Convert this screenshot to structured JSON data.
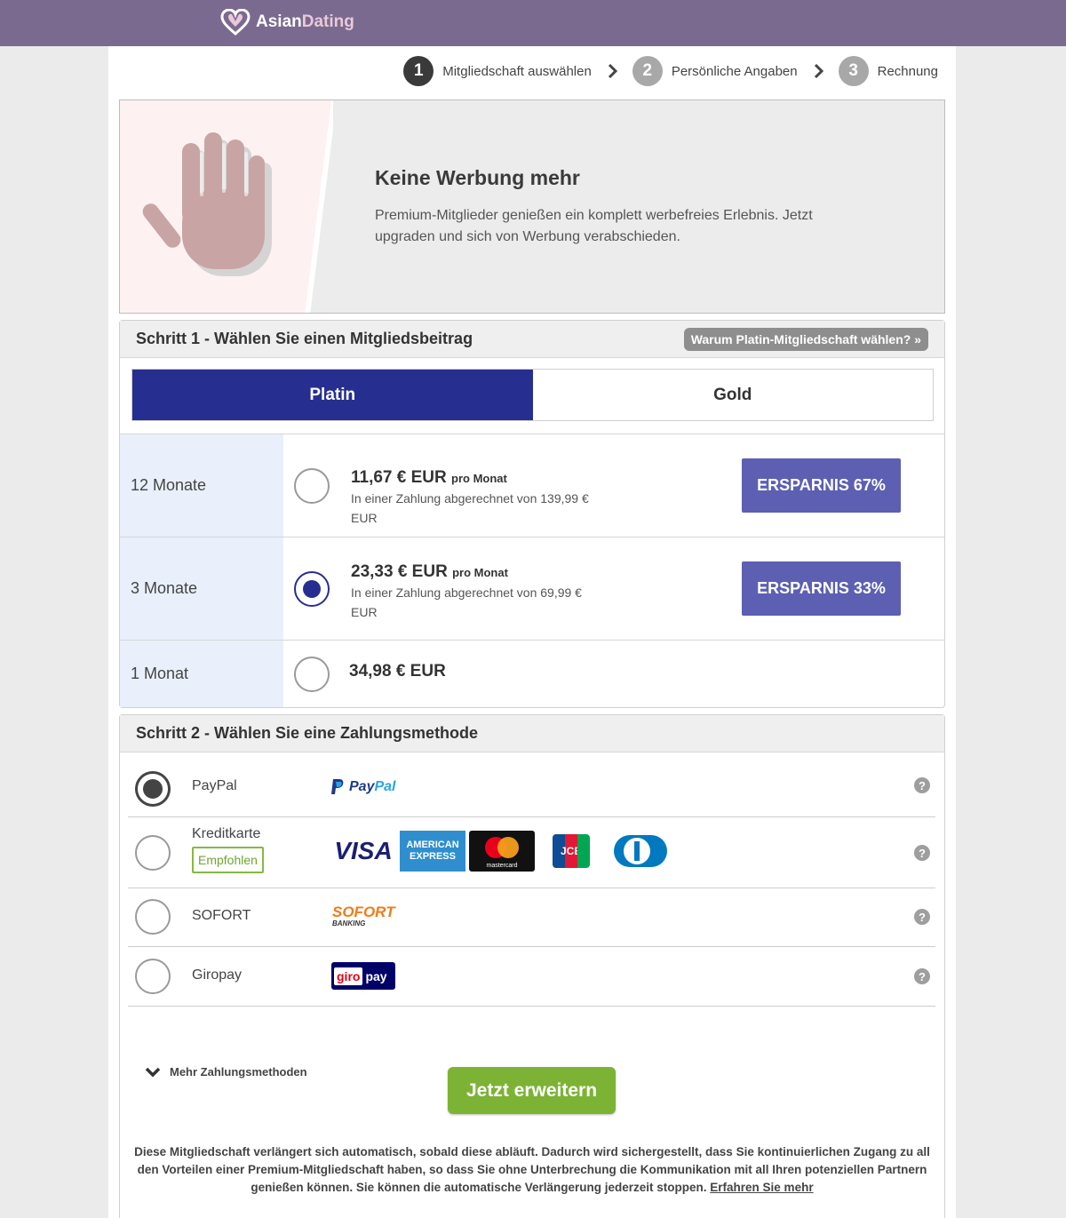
{
  "header": {
    "logo_part1": "Asian",
    "logo_part2": "Dating"
  },
  "steps": [
    {
      "num": "1",
      "label": "Mitgliedschaft auswählen"
    },
    {
      "num": "2",
      "label": "Persönliche Angaben"
    },
    {
      "num": "3",
      "label": "Rechnung"
    }
  ],
  "banner": {
    "title": "Keine Werbung mehr",
    "text": "Premium-Mitglieder genießen ein komplett werbefreies Erlebnis. Jetzt upgraden und sich von Werbung verabschieden."
  },
  "step1": {
    "title": "Schritt 1 - Wählen Sie einen Mitgliedsbeitrag",
    "why_button": "Warum Platin-Mitgliedschaft wählen? »",
    "tabs": [
      {
        "label": "Platin"
      },
      {
        "label": "Gold"
      }
    ],
    "plans": [
      {
        "duration": "12 Monate",
        "price": "11,67 € EUR",
        "per": "pro Monat",
        "billing": "In einer Zahlung abgerechnet von 139,99 € EUR",
        "saving": "ERSPARNIS 67%"
      },
      {
        "duration": "3 Monate",
        "price": "23,33 € EUR",
        "per": "pro Monat",
        "billing": "In einer Zahlung abgerechnet von 69,99 € EUR",
        "saving": "ERSPARNIS 33%"
      },
      {
        "duration": "1 Monat",
        "price": "34,98 € EUR"
      }
    ]
  },
  "step2": {
    "title": "Schritt 2 - Wählen Sie eine Zahlungsmethode",
    "methods": [
      {
        "name": "PayPal",
        "logo": "PayPal"
      },
      {
        "name": "Kreditkarte",
        "badge": "Empfohlen",
        "logos": [
          "VISA",
          "AMERICAN EXPRESS",
          "mastercard",
          "JCB",
          "Diners Club"
        ]
      },
      {
        "name": "SOFORT",
        "logo": "SOFORT",
        "logo_sub": "BANKING"
      },
      {
        "name": "Giropay",
        "logo_a": "giro",
        "logo_b": "pay"
      }
    ],
    "help_glyph": "?",
    "more_label": "Mehr Zahlungsmethoden"
  },
  "cta": {
    "label": "Jetzt erweitern"
  },
  "legal": {
    "text": "Diese Mitgliedschaft verlängert sich automatisch, sobald diese abläuft. Dadurch wird sichergestellt, dass Sie kontinuierlichen Zugang zu all den Vorteilen einer Premium-Mitgliedschaft haben, so dass Sie ohne Unterbrechung die Kommunikation mit all Ihren potenziellen Partnern genießen können. Sie können die automatische Verlängerung jederzeit stoppen.",
    "link": "Erfahren Sie mehr"
  },
  "colors": {
    "header_bg": "#7b6a8f",
    "tab_active": "#262f8f",
    "saving_badge": "#5c5fb2",
    "cta": "#7cb335",
    "plan_label_bg": "#e9f0fb",
    "recommended": "#86b843"
  }
}
